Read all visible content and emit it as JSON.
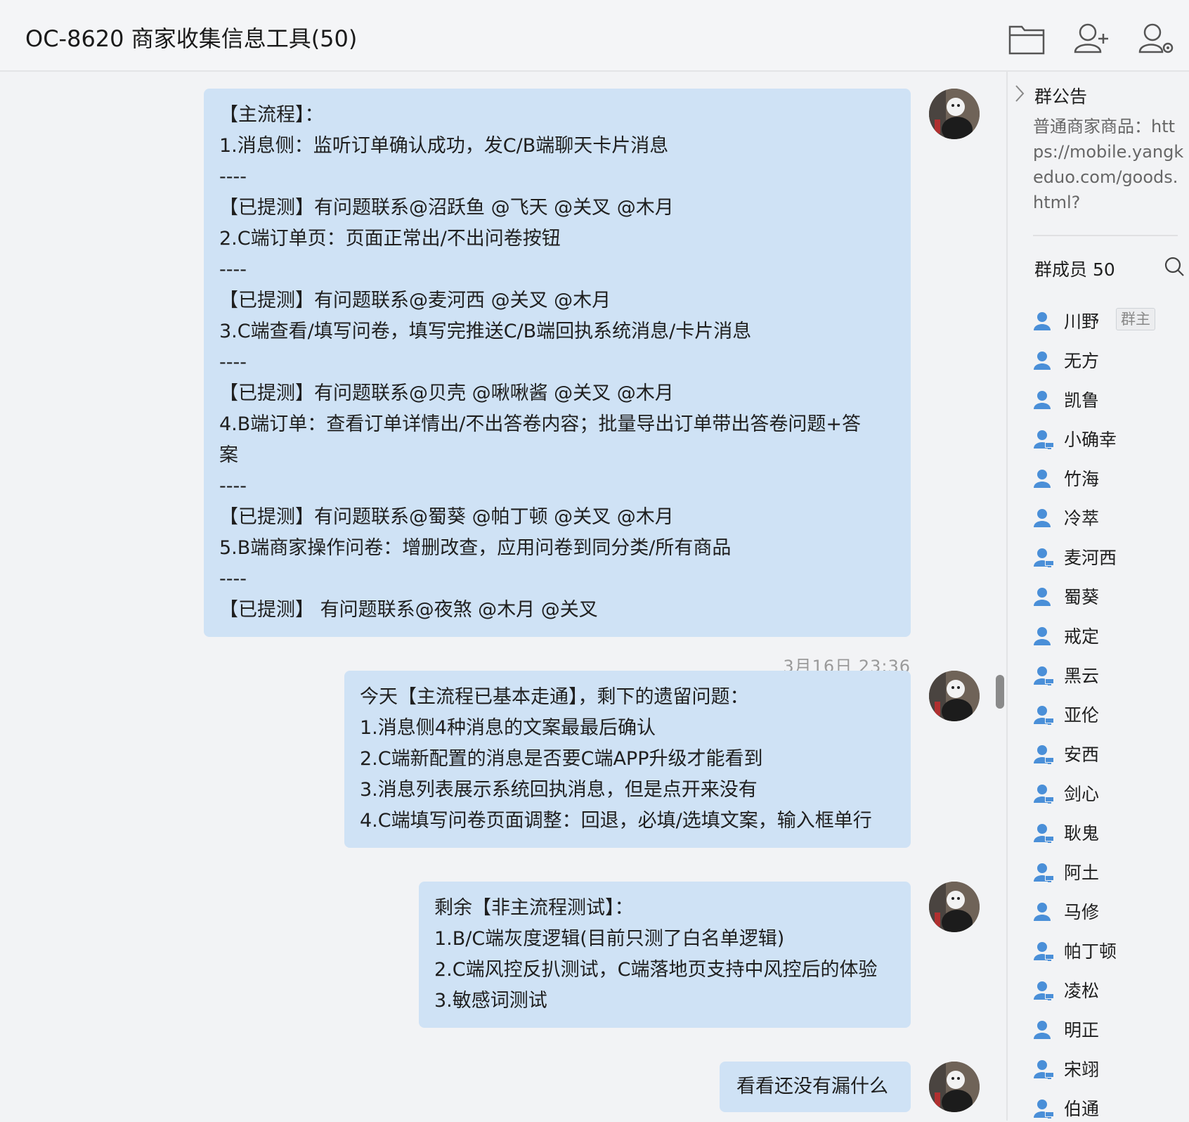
{
  "header": {
    "title": "OC-8620 商家收集信息工具(50)"
  },
  "messages": [
    {
      "lines": [
        "【主流程】：",
        "1.消息侧：监听订单确认成功，发C/B端聊天卡片消息",
        "----",
        "【已提测】有问题联系@沼跃鱼 @飞天 @关叉 @木月",
        "2.C端订单页：页面正常出/不出问卷按钮",
        "----",
        "【已提测】有问题联系@麦河西 @关叉 @木月",
        "3.C端查看/填写问卷，填写完推送C/B端回执系统消息/卡片消息",
        "----",
        "【已提测】有问题联系@贝壳 @啾啾酱 @关叉 @木月",
        "4.B端订单：查看订单详情出/不出答卷内容；批量导出订单带出答卷问题+答",
        "案",
        "----",
        "【已提测】有问题联系@蜀葵 @帕丁顿 @关叉 @木月",
        "5.B端商家操作问卷：增删改查，应用问卷到同分类/所有商品",
        "----",
        "【已提测】 有问题联系@夜煞 @木月 @关叉"
      ]
    },
    {
      "lines": [
        "今天【主流程已基本走通】，剩下的遗留问题：",
        "1.消息侧4种消息的文案最最后确认",
        "2.C端新配置的消息是否要C端APP升级才能看到",
        "3.消息列表展示系统回执消息，但是点开来没有",
        "4.C端填写问卷页面调整：回退，必填/选填文案，输入框单行"
      ]
    },
    {
      "lines": [
        "剩余【非主流程测试】：",
        "1.B/C端灰度逻辑(目前只测了白名单逻辑)",
        "2.C端风控反扒测试，C端落地页支持中风控后的体验",
        "3.敏感词测试"
      ]
    },
    {
      "lines": [
        "看看还没有漏什么"
      ]
    }
  ],
  "timestamp": "3月16日 23:36",
  "sidebar": {
    "announcement_title": "群公告",
    "announcement_text": "普通商家商品：https://mobile.yangkeduo.com/goods.html?",
    "members_label": "群成员 50",
    "owner_badge": "群主",
    "members": [
      {
        "name": "川野",
        "type": "user"
      },
      {
        "name": "无方",
        "type": "user"
      },
      {
        "name": "凯鲁",
        "type": "user"
      },
      {
        "name": "小确幸",
        "type": "desktop"
      },
      {
        "name": "竹海",
        "type": "user"
      },
      {
        "name": "冷萃",
        "type": "user"
      },
      {
        "name": "麦河西",
        "type": "desktop"
      },
      {
        "name": "蜀葵",
        "type": "user"
      },
      {
        "name": "戒定",
        "type": "user"
      },
      {
        "name": "黑云",
        "type": "desktop"
      },
      {
        "name": "亚伦",
        "type": "desktop"
      },
      {
        "name": "安西",
        "type": "desktop"
      },
      {
        "name": "剑心",
        "type": "desktop"
      },
      {
        "name": "耿鬼",
        "type": "desktop"
      },
      {
        "name": "阿土",
        "type": "desktop"
      },
      {
        "name": "马修",
        "type": "user"
      },
      {
        "name": "帕丁顿",
        "type": "desktop"
      },
      {
        "name": "凌松",
        "type": "desktop"
      },
      {
        "name": "明正",
        "type": "user"
      },
      {
        "name": "宋翊",
        "type": "desktop"
      },
      {
        "name": "伯通",
        "type": "desktop"
      }
    ]
  },
  "colors": {
    "bubble": "#cfe2f5",
    "accent": "#4a8fd8",
    "background": "#f2f3f5"
  }
}
